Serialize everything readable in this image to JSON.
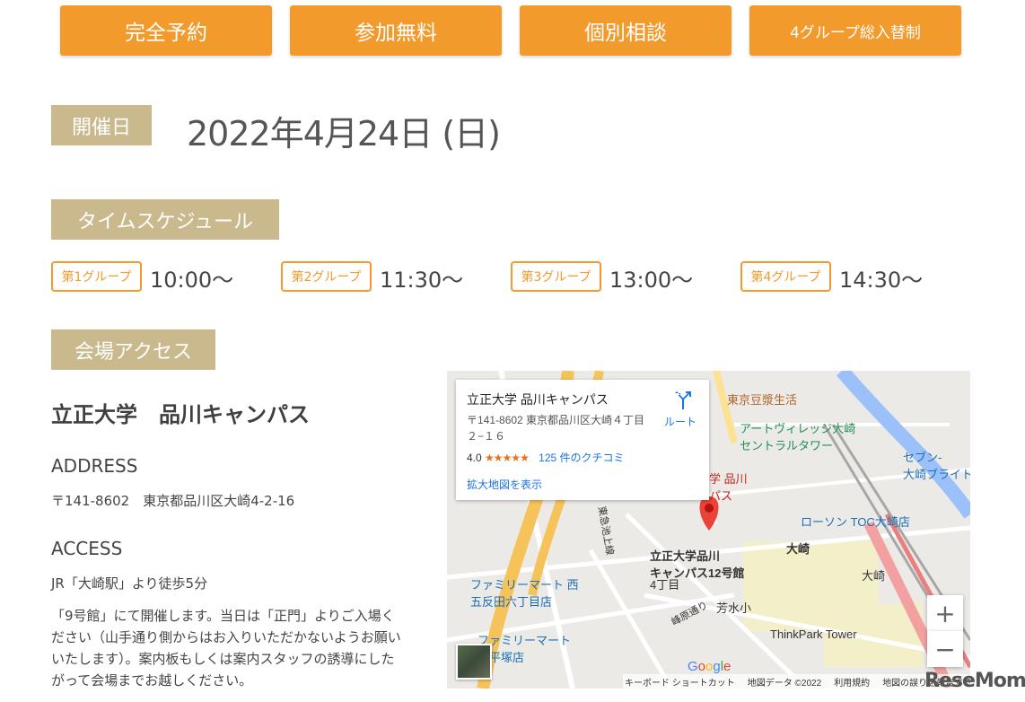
{
  "features": [
    "完全予約",
    "参加無料",
    "個別相談",
    "4グループ総入替制"
  ],
  "date_section": {
    "label": "開催日",
    "date": "2022年4月24日 (日)"
  },
  "schedule_section": {
    "label": "タイムスケジュール",
    "groups": [
      {
        "name": "第1グループ",
        "time": "10:00〜"
      },
      {
        "name": "第2グループ",
        "time": "11:30〜"
      },
      {
        "name": "第3グループ",
        "time": "13:00〜"
      },
      {
        "name": "第4グループ",
        "time": "14:30〜"
      }
    ]
  },
  "access_section": {
    "label": "会場アクセス",
    "venue_name": "立正大学　品川キャンパス",
    "address_heading": "ADDRESS",
    "address": "〒141-8602　東京都品川区大崎4-2-16",
    "access_heading": "ACCESS",
    "access_route": "JR「大崎駅」より徒歩5分",
    "description": "「9号館」にて開催します。当日は「正門」よりご入場ください（山手通り側からはお入りいただかないようお願いいたします）。案内板もしくは案内スタッフの誘導にしたがって会場までお越しください。"
  },
  "map": {
    "card": {
      "title": "立正大学 品川キャンパス",
      "address": "〒141-8602 東京都品川区大崎４丁目２−１６",
      "rating": "4.0",
      "stars": "★★★★★",
      "reviews": "125 件のクチコミ",
      "larger_map": "拡大地図を表示",
      "route": "ルート"
    },
    "labels": {
      "tofu": "東京豆漿生活",
      "artvillage": "アートヴィレッジ大崎\nセントラルタワー",
      "seven": "セブン-\n大崎ブライト",
      "lawson": "ローソン TOC大崎店",
      "campus": "立正大学品川\nキャンパス12号館",
      "osaki": "大崎",
      "osaki_station": "大崎",
      "familymart1": "ファミリーマート 西\n五反田六丁目店",
      "yonchome": "4丁目",
      "housui": "芳水小",
      "mineharadori": "峰原通り",
      "thinkpark": "ThinkPark Tower",
      "familymart2": "ファミリーマート\n川平塚店",
      "campus_pin": "学 品川\nパス",
      "tokyu": "東急池上線"
    },
    "zoom_in": "+",
    "zoom_out": "−",
    "google": "Google",
    "attribution": [
      "キーボード ショートカット",
      "地図データ ©2022",
      "利用規約",
      "地図の誤りを報告する"
    ]
  },
  "watermark": "ReseMom"
}
